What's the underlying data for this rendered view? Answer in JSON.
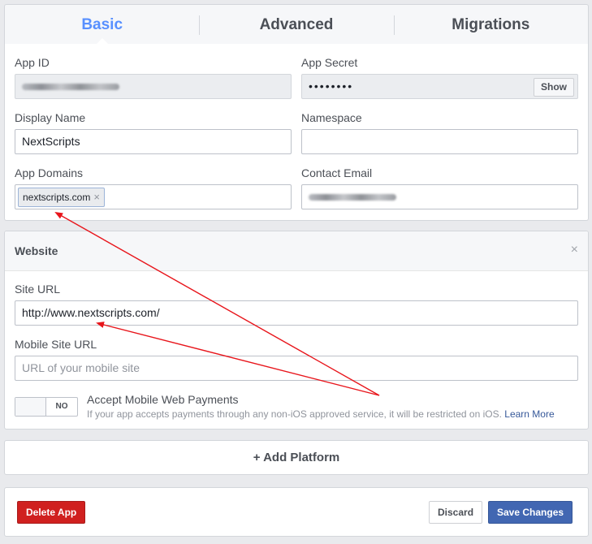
{
  "tabs": [
    {
      "label": "Basic",
      "active": true
    },
    {
      "label": "Advanced",
      "active": false
    },
    {
      "label": "Migrations",
      "active": false
    }
  ],
  "basic": {
    "app_id_label": "App ID",
    "app_secret_label": "App Secret",
    "app_secret_value": "••••••••",
    "show_label": "Show",
    "display_name_label": "Display Name",
    "display_name_value": "NextScripts",
    "namespace_label": "Namespace",
    "namespace_value": "",
    "app_domains_label": "App Domains",
    "app_domain_token": "nextscripts.com",
    "token_remove": "×",
    "contact_email_label": "Contact Email"
  },
  "website": {
    "title": "Website",
    "close": "×",
    "site_url_label": "Site URL",
    "site_url_value": "http://www.nextscripts.com/",
    "mobile_site_url_label": "Mobile Site URL",
    "mobile_site_url_placeholder": "URL of your mobile site",
    "toggle_label": "NO",
    "payments_title": "Accept Mobile Web Payments",
    "payments_desc": "If your app accepts payments through any non-iOS approved service, it will be restricted on iOS.",
    "learn_more": "Learn More"
  },
  "add_platform": "+ Add Platform",
  "footer": {
    "delete_label": "Delete App",
    "discard_label": "Discard",
    "save_label": "Save Changes"
  },
  "colors": {
    "active_tab": "#5890ff",
    "annotation_arrow": "#e8151b",
    "delete_button": "#d0201f",
    "save_button": "#4267b2"
  }
}
